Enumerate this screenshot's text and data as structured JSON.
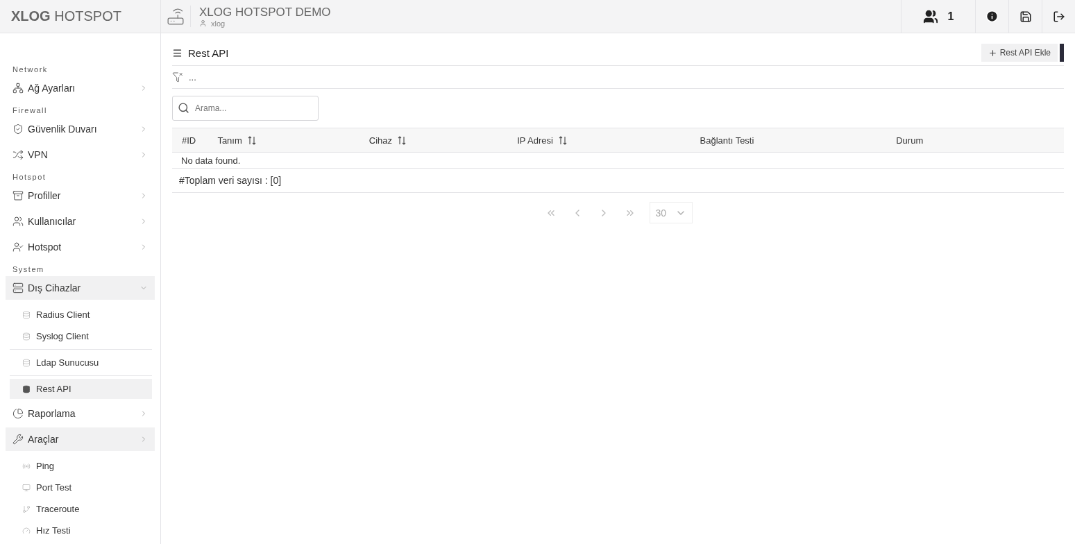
{
  "brand": {
    "strong": "XLOG",
    "light": "HOTSPOT"
  },
  "header": {
    "title": "XLOG HOTSPOT DEMO",
    "user": "xlog",
    "online_count": "1"
  },
  "sidebar": {
    "sections": [
      {
        "heading": "Network",
        "items": [
          {
            "label": "Ağ Ayarları",
            "highlighted": false,
            "expanded": false
          }
        ]
      },
      {
        "heading": "Firewall",
        "items": [
          {
            "label": "Güvenlik Duvarı",
            "highlighted": false,
            "expanded": false
          },
          {
            "label": "VPN",
            "highlighted": false,
            "expanded": false
          }
        ]
      },
      {
        "heading": "Hotspot",
        "items": [
          {
            "label": "Profiller",
            "highlighted": false,
            "expanded": false
          },
          {
            "label": "Kullanıcılar",
            "highlighted": false,
            "expanded": false
          },
          {
            "label": "Hotspot",
            "highlighted": false,
            "expanded": false
          }
        ]
      },
      {
        "heading": "System",
        "items": [
          {
            "label": "Dış Cihazlar",
            "highlighted": true,
            "expanded": true,
            "children": [
              {
                "items": [
                  {
                    "label": "Radius Client",
                    "selected": false
                  },
                  {
                    "label": "Syslog Client",
                    "selected": false
                  }
                ]
              },
              {
                "items": [
                  {
                    "label": "Ldap Sunucusu",
                    "selected": false
                  }
                ]
              },
              {
                "items": [
                  {
                    "label": "Rest API",
                    "selected": true
                  }
                ]
              }
            ]
          },
          {
            "label": "Raporlama",
            "highlighted": false,
            "expanded": false
          },
          {
            "label": "Araçlar",
            "highlighted": true,
            "expanded": false,
            "children": [
              {
                "items": [
                  {
                    "label": "Ping",
                    "selected": false
                  },
                  {
                    "label": "Port Test",
                    "selected": false
                  },
                  {
                    "label": "Traceroute",
                    "selected": false
                  },
                  {
                    "label": "Hız Testi",
                    "selected": false
                  }
                ]
              }
            ]
          }
        ]
      }
    ]
  },
  "page": {
    "title": "Rest API",
    "add_button": "Rest API Ekle",
    "filter_text": "...",
    "search": {
      "placeholder": "Arama..."
    }
  },
  "table": {
    "columns": [
      {
        "label": "#ID",
        "sortable": false
      },
      {
        "label": "Tanım",
        "sortable": true
      },
      {
        "label": "Cihaz",
        "sortable": true
      },
      {
        "label": "IP Adresi",
        "sortable": true
      },
      {
        "label": "Bağlantı Testi",
        "sortable": false
      },
      {
        "label": "Durum",
        "sortable": false
      }
    ],
    "empty_message": "No data found.",
    "total": "#Toplam veri sayısı : [0]"
  },
  "pagination": {
    "page_size": "30"
  }
}
